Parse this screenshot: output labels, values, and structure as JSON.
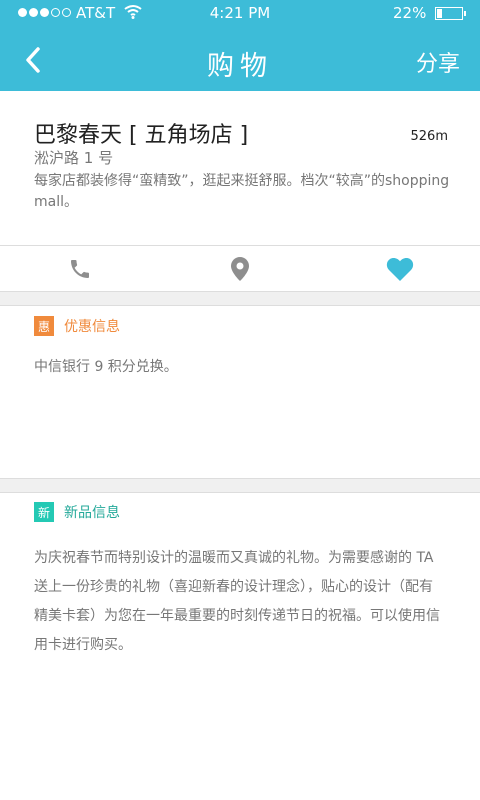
{
  "status": {
    "carrier": "AT&T",
    "time": "4:21 PM",
    "battery": "22%",
    "battery_level": 0.22,
    "signal_bars": 3
  },
  "nav": {
    "title": "购物",
    "share": "分享"
  },
  "store": {
    "name": "巴黎春天 [ 五角场店 ]",
    "distance": "526m",
    "address": "淞沪路 1 号",
    "description": "每家店都装修得“蛮精致”，逛起来挺舒服。档次“较高”的shopping mall。"
  },
  "promo": {
    "badge": "惠",
    "title": "优惠信息",
    "body": "中信银行 9 积分兑换。"
  },
  "product": {
    "badge": "新",
    "title": "新品信息",
    "body": "为庆祝春节而特别设计的温暖而又真诚的礼物。为需要感谢的 TA 送上一份珍贵的礼物（喜迎新春的设计理念），贴心的设计（配有精美卡套）为您在一年最重要的时刻传递节日的祝福。可以使用信用卡进行购买。"
  },
  "colors": {
    "brand": "#3dbcd8",
    "promo_accent": "#f08a3c",
    "new_accent": "#24c9b4",
    "icon_gray": "#8e8e8e",
    "heart": "#3dbcd8"
  },
  "icons": [
    "back-chevron",
    "phone-icon",
    "location-pin-icon",
    "heart-icon",
    "wifi-icon",
    "battery-icon"
  ]
}
